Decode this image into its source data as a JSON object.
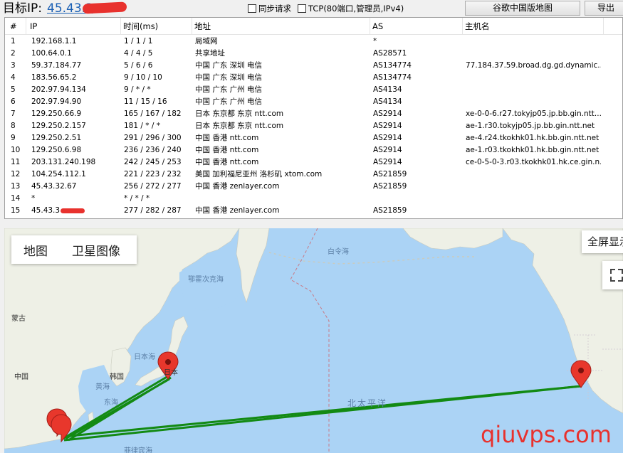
{
  "header": {
    "target_label": "目标IP:",
    "target_ip": "45.43.3",
    "sync_label": "同步请求",
    "tcp_label": "TCP(80端口,管理员,IPv4)",
    "google_map_button": "谷歌中国版地图",
    "export_button": "导出"
  },
  "table": {
    "columns": [
      "#",
      "IP",
      "时间(ms)",
      "地址",
      "AS",
      "主机名"
    ],
    "rows": [
      [
        "1",
        "192.168.1.1",
        "1 / 1 / 1",
        "局域网",
        "*",
        ""
      ],
      [
        "2",
        "100.64.0.1",
        "4 / 4 / 5",
        "共享地址",
        "AS28571",
        ""
      ],
      [
        "3",
        "59.37.184.77",
        "5 / 6 / 6",
        "中国 广东 深圳 电信",
        "AS134774",
        "77.184.37.59.broad.dg.gd.dynamic..."
      ],
      [
        "4",
        "183.56.65.2",
        "9 / 10 / 10",
        "中国 广东 深圳 电信",
        "AS134774",
        ""
      ],
      [
        "5",
        "202.97.94.134",
        "9 / * / *",
        "中国 广东 广州 电信",
        "AS4134",
        ""
      ],
      [
        "6",
        "202.97.94.90",
        "11 / 15 / 16",
        "中国 广东 广州 电信",
        "AS4134",
        ""
      ],
      [
        "7",
        "129.250.66.9",
        "165 / 167 / 182",
        "日本 东京都 东京 ntt.com",
        "AS2914",
        "xe-0-0-6.r27.tokyjp05.jp.bb.gin.ntt...."
      ],
      [
        "8",
        "129.250.2.157",
        "181 / * / *",
        "日本 东京都 东京 ntt.com",
        "AS2914",
        "ae-1.r30.tokyjp05.jp.bb.gin.ntt.net"
      ],
      [
        "9",
        "129.250.2.51",
        "291 / 296 / 300",
        "中国 香港 ntt.com",
        "AS2914",
        "ae-4.r24.tkokhk01.hk.bb.gin.ntt.net"
      ],
      [
        "10",
        "129.250.6.98",
        "236 / 236 / 240",
        "中国 香港 ntt.com",
        "AS2914",
        "ae-1.r03.tkokhk01.hk.bb.gin.ntt.net"
      ],
      [
        "11",
        "203.131.240.198",
        "242 / 245 / 253",
        "中国 香港 ntt.com",
        "AS2914",
        "ce-0-5-0-3.r03.tkokhk01.hk.ce.gin.n..."
      ],
      [
        "12",
        "104.254.112.1",
        "221 / 223 / 232",
        "美国 加利福尼亚州 洛杉矶 xtom.com",
        "AS21859",
        ""
      ],
      [
        "13",
        "45.43.32.67",
        "256 / 272 / 277",
        "中国 香港 zenlayer.com",
        "AS21859",
        ""
      ],
      [
        "14",
        "*",
        "* / * / *",
        "",
        "",
        ""
      ],
      [
        "15",
        "45.43.3",
        "277 / 282 / 287",
        "中国 香港 zenlayer.com",
        "AS21859",
        ""
      ]
    ]
  },
  "map": {
    "tab_map": "地图",
    "tab_satellite": "卫星图像",
    "fullscreen": "全屏显示",
    "labels": {
      "okhotsk": "鄂霍次克海",
      "bering": "白令海",
      "mongolia": "蒙古",
      "japan_sea": "日本海",
      "japan": "日本",
      "china": "中国",
      "korea": "韩国",
      "yellow_sea": "黄海",
      "east_sea": "东海",
      "north_pacific": "北太平洋",
      "philippine_sea": "菲律宾海"
    },
    "route_color": "#138a13",
    "marker_color": "#e8372c",
    "water_color": "#abd3f5",
    "land_color": "#eef0e6"
  },
  "watermark": "qiuvps.com"
}
